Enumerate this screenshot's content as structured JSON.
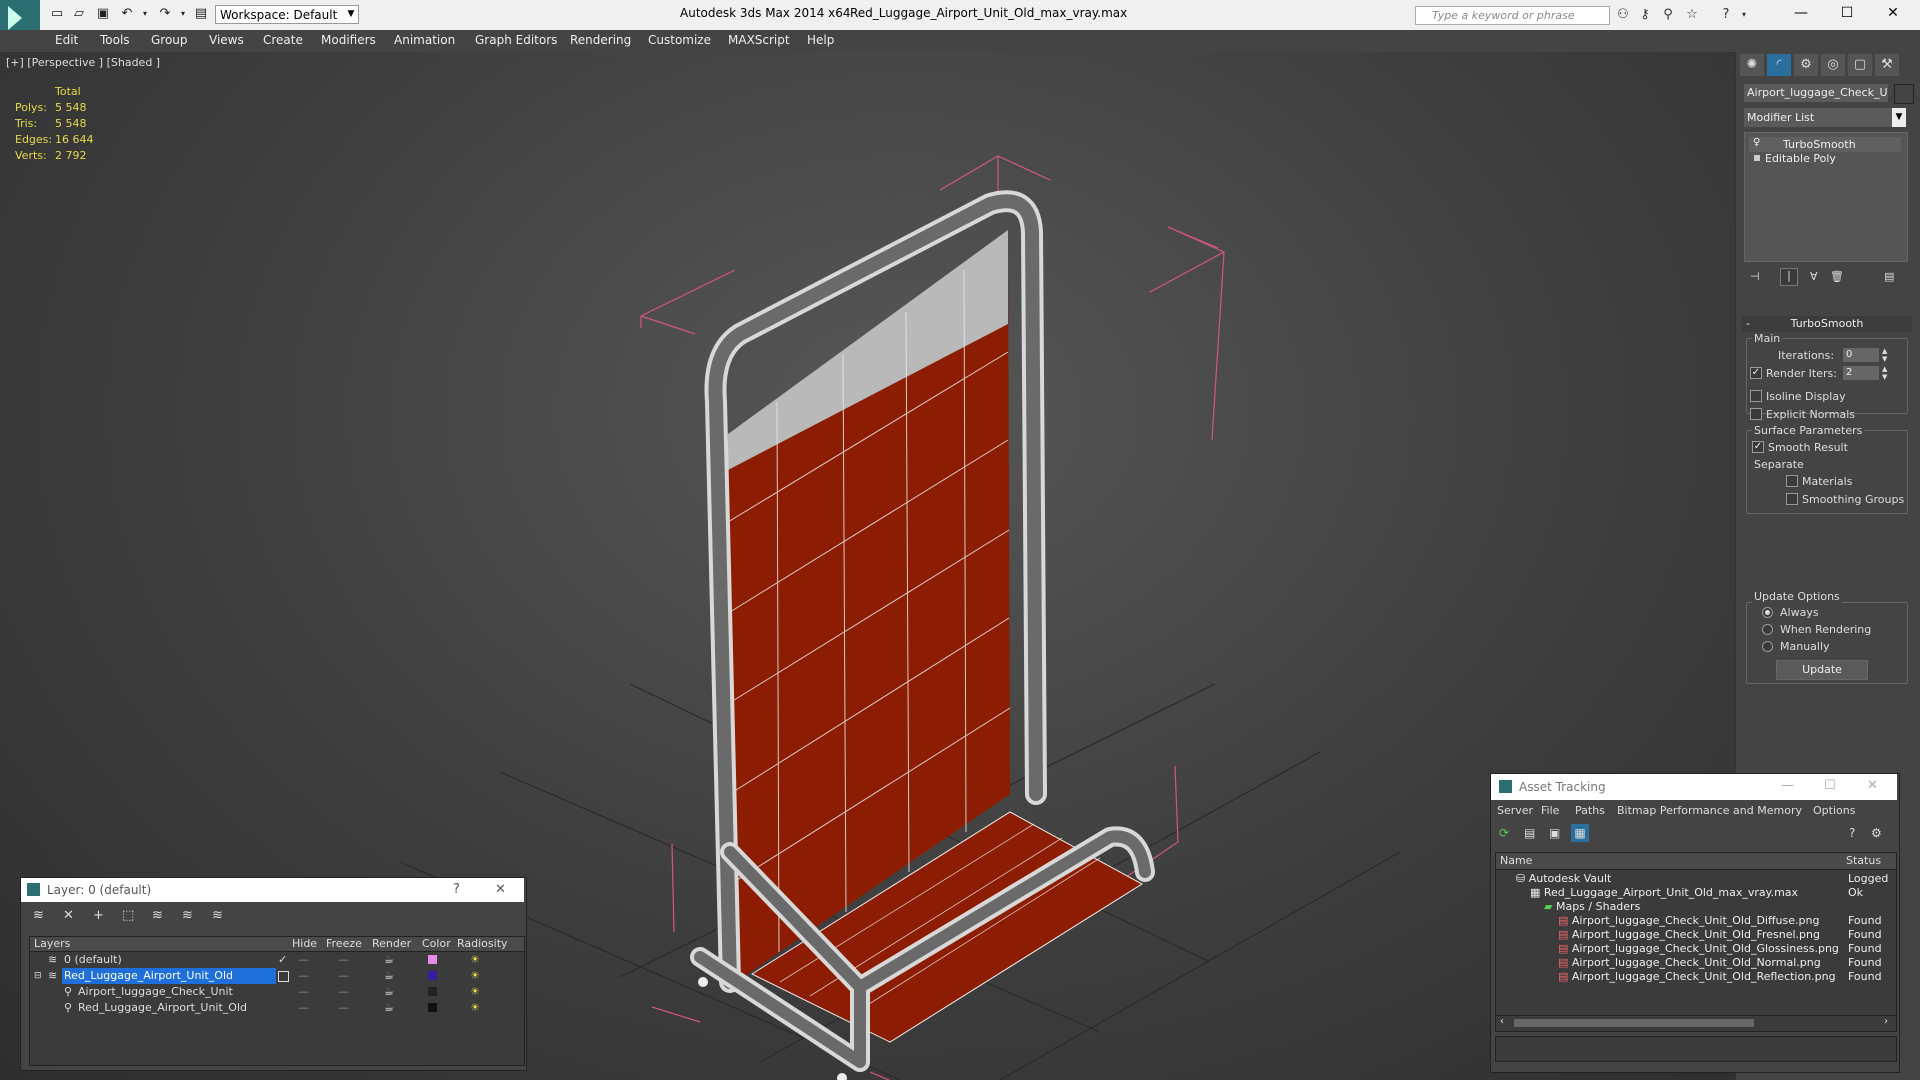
{
  "titlebar": {
    "workspace": "Workspace: Default",
    "app_title": "Autodesk 3ds Max  2014 x64",
    "file_title": "Red_Luggage_Airport_Unit_Old_max_vray.max",
    "search_placeholder": "Type a keyword or phrase",
    "minimize": "—",
    "maximize": "☐",
    "close": "✕"
  },
  "menu": [
    "Edit",
    "Tools",
    "Group",
    "Views",
    "Create",
    "Modifiers",
    "Animation",
    "Graph Editors",
    "Rendering",
    "Customize",
    "MAXScript",
    "Help"
  ],
  "viewport": {
    "label": "[+] [Perspective ] [Shaded ]",
    "stats": {
      "header": "Total",
      "rows": [
        {
          "label": "Polys:",
          "value": "5 548"
        },
        {
          "label": "Tris:",
          "value": "5 548"
        },
        {
          "label": "Edges:",
          "value": "16 644"
        },
        {
          "label": "Verts:",
          "value": "2 792"
        }
      ]
    }
  },
  "command_panel": {
    "object_name": "Airport_luggage_Check_Unit",
    "modifier_list": "Modifier List",
    "stack": [
      "TurboSmooth",
      "Editable Poly"
    ],
    "rollout_title": "TurboSmooth",
    "main_label": "Main",
    "iterations_label": "Iterations:",
    "iterations_value": "0",
    "render_iters_label": "Render Iters:",
    "render_iters_value": "2",
    "isoline_display": "Isoline Display",
    "explicit_normals": "Explicit Normals",
    "surface_params": "Surface Parameters",
    "smooth_result": "Smooth Result",
    "separate": "Separate",
    "materials": "Materials",
    "smoothing_groups": "Smoothing Groups",
    "update_options": "Update Options",
    "always": "Always",
    "when_rendering": "When Rendering",
    "manually": "Manually",
    "update_button": "Update"
  },
  "layer_dialog": {
    "title": "Layer: 0 (default)",
    "help": "?",
    "close": "✕",
    "columns": [
      "Layers",
      "Hide",
      "Freeze",
      "Render",
      "Color",
      "Radiosity"
    ],
    "rows": [
      {
        "name": "0 (default)",
        "color": "#e88ae8"
      },
      {
        "name": "Red_Luggage_Airport_Unit_Old",
        "color": "#3a1aa0"
      },
      {
        "name": "Airport_luggage_Check_Unit",
        "color": "#222222"
      },
      {
        "name": "Red_Luggage_Airport_Unit_Old",
        "color": "#111111"
      }
    ]
  },
  "asset_dialog": {
    "title": "Asset Tracking",
    "menu": [
      "Server",
      "File",
      "Paths",
      "Bitmap Performance and Memory",
      "Options"
    ],
    "columns": [
      "Name",
      "Status"
    ],
    "rows": [
      {
        "name": "Autodesk Vault",
        "status": "Logged"
      },
      {
        "name": "Red_Luggage_Airport_Unit_Old_max_vray.max",
        "status": "Ok"
      },
      {
        "name": "Maps / Shaders",
        "status": ""
      },
      {
        "name": "Airport_luggage_Check_Unit_Old_Diffuse.png",
        "status": "Found"
      },
      {
        "name": "Airport_luggage_Check_Unit_Old_Fresnel.png",
        "status": "Found"
      },
      {
        "name": "Airport_luggage_Check_Unit_Old_Glossiness.png",
        "status": "Found"
      },
      {
        "name": "Airport_luggage_Check_Unit_Old_Normal.png",
        "status": "Found"
      },
      {
        "name": "Airport_luggage_Check_Unit_Old_Reflection.png",
        "status": "Found"
      }
    ]
  },
  "colors": {
    "accent": "#2b6f73",
    "model_red": "#8b1a00",
    "stats_yellow": "#e6d94a",
    "selected_row": "#1e6fd9"
  }
}
